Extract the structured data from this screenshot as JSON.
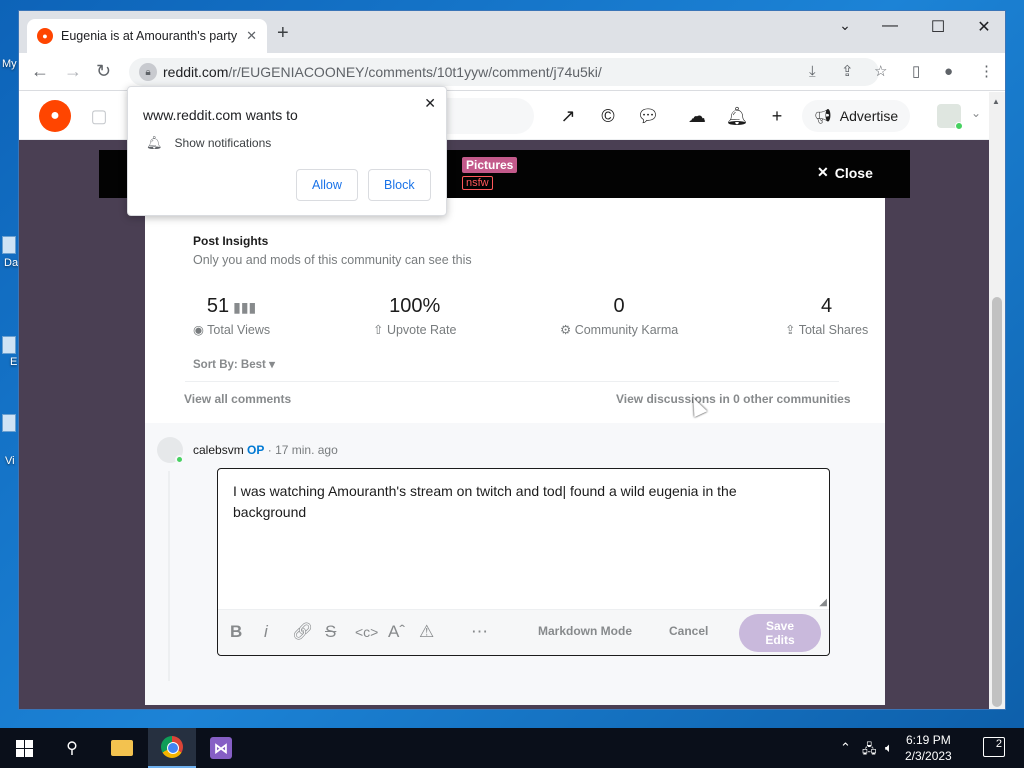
{
  "desktop": {
    "icons": [
      {
        "label": "My"
      },
      {
        "label": "Da"
      },
      {
        "label": "E"
      },
      {
        "label": "Vi"
      }
    ]
  },
  "browser": {
    "tab_title": "Eugenia is at Amouranth's party",
    "new_tab": "+",
    "url_host": "reddit.com",
    "url_path": "/r/EUGENIACOONEY/comments/10t1yyw/comment/j74u5ki/",
    "controls": {
      "minimize": "—",
      "maximize": "☐",
      "close": "✕",
      "tablist": "⌄"
    }
  },
  "reddit_header": {
    "advertise_label": "Advertise"
  },
  "post_bar": {
    "flair": "Pictures",
    "nsfw": "nsfw",
    "close_label": "Close"
  },
  "insights": {
    "title": "Post Insights",
    "subtitle": "Only you and mods of this community can see this",
    "stats": [
      {
        "value": "51",
        "label": "Total Views"
      },
      {
        "value": "100%",
        "label": "Upvote Rate"
      },
      {
        "value": "0",
        "label": "Community Karma"
      },
      {
        "value": "4",
        "label": "Total Shares"
      }
    ],
    "sort_label": "Sort By: Best",
    "view_all": "View all comments",
    "view_discussions": "View discussions in 0 other communities"
  },
  "comment": {
    "author": "calebsvm",
    "op_badge": "OP",
    "time": "17 min. ago",
    "text": "I was watching Amouranth's stream on twitch and tod| found a wild eugenia in the background",
    "markdown_mode": "Markdown Mode",
    "cancel": "Cancel",
    "save_line1": "Save",
    "save_line2": "Edits"
  },
  "notification": {
    "title": "www.reddit.com wants to",
    "permission": "Show notifications",
    "allow": "Allow",
    "block": "Block"
  },
  "taskbar": {
    "time": "6:19 PM",
    "date": "2/3/2023",
    "notification_count": "2"
  }
}
